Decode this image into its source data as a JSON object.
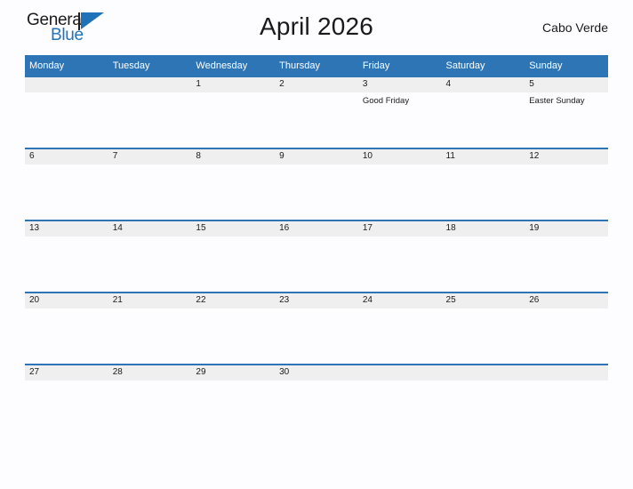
{
  "brand": {
    "word_one": "General",
    "word_two": "Blue",
    "primary_color": "#2272b8"
  },
  "header": {
    "title": "April 2026",
    "locale": "Cabo Verde"
  },
  "theme": {
    "header_blue": "#2e75b6",
    "strip_gray": "#efefef",
    "text_color": "#1a1a1a"
  },
  "calendar": {
    "weekdays": [
      "Monday",
      "Tuesday",
      "Wednesday",
      "Thursday",
      "Friday",
      "Saturday",
      "Sunday"
    ],
    "weeks": [
      [
        {
          "day": "",
          "events": []
        },
        {
          "day": "",
          "events": []
        },
        {
          "day": "1",
          "events": []
        },
        {
          "day": "2",
          "events": []
        },
        {
          "day": "3",
          "events": [
            "Good Friday"
          ]
        },
        {
          "day": "4",
          "events": []
        },
        {
          "day": "5",
          "events": [
            "Easter Sunday"
          ]
        }
      ],
      [
        {
          "day": "6",
          "events": []
        },
        {
          "day": "7",
          "events": []
        },
        {
          "day": "8",
          "events": []
        },
        {
          "day": "9",
          "events": []
        },
        {
          "day": "10",
          "events": []
        },
        {
          "day": "11",
          "events": []
        },
        {
          "day": "12",
          "events": []
        }
      ],
      [
        {
          "day": "13",
          "events": []
        },
        {
          "day": "14",
          "events": []
        },
        {
          "day": "15",
          "events": []
        },
        {
          "day": "16",
          "events": []
        },
        {
          "day": "17",
          "events": []
        },
        {
          "day": "18",
          "events": []
        },
        {
          "day": "19",
          "events": []
        }
      ],
      [
        {
          "day": "20",
          "events": []
        },
        {
          "day": "21",
          "events": []
        },
        {
          "day": "22",
          "events": []
        },
        {
          "day": "23",
          "events": []
        },
        {
          "day": "24",
          "events": []
        },
        {
          "day": "25",
          "events": []
        },
        {
          "day": "26",
          "events": []
        }
      ],
      [
        {
          "day": "27",
          "events": []
        },
        {
          "day": "28",
          "events": []
        },
        {
          "day": "29",
          "events": []
        },
        {
          "day": "30",
          "events": []
        },
        {
          "day": "",
          "events": []
        },
        {
          "day": "",
          "events": []
        },
        {
          "day": "",
          "events": []
        }
      ]
    ]
  }
}
